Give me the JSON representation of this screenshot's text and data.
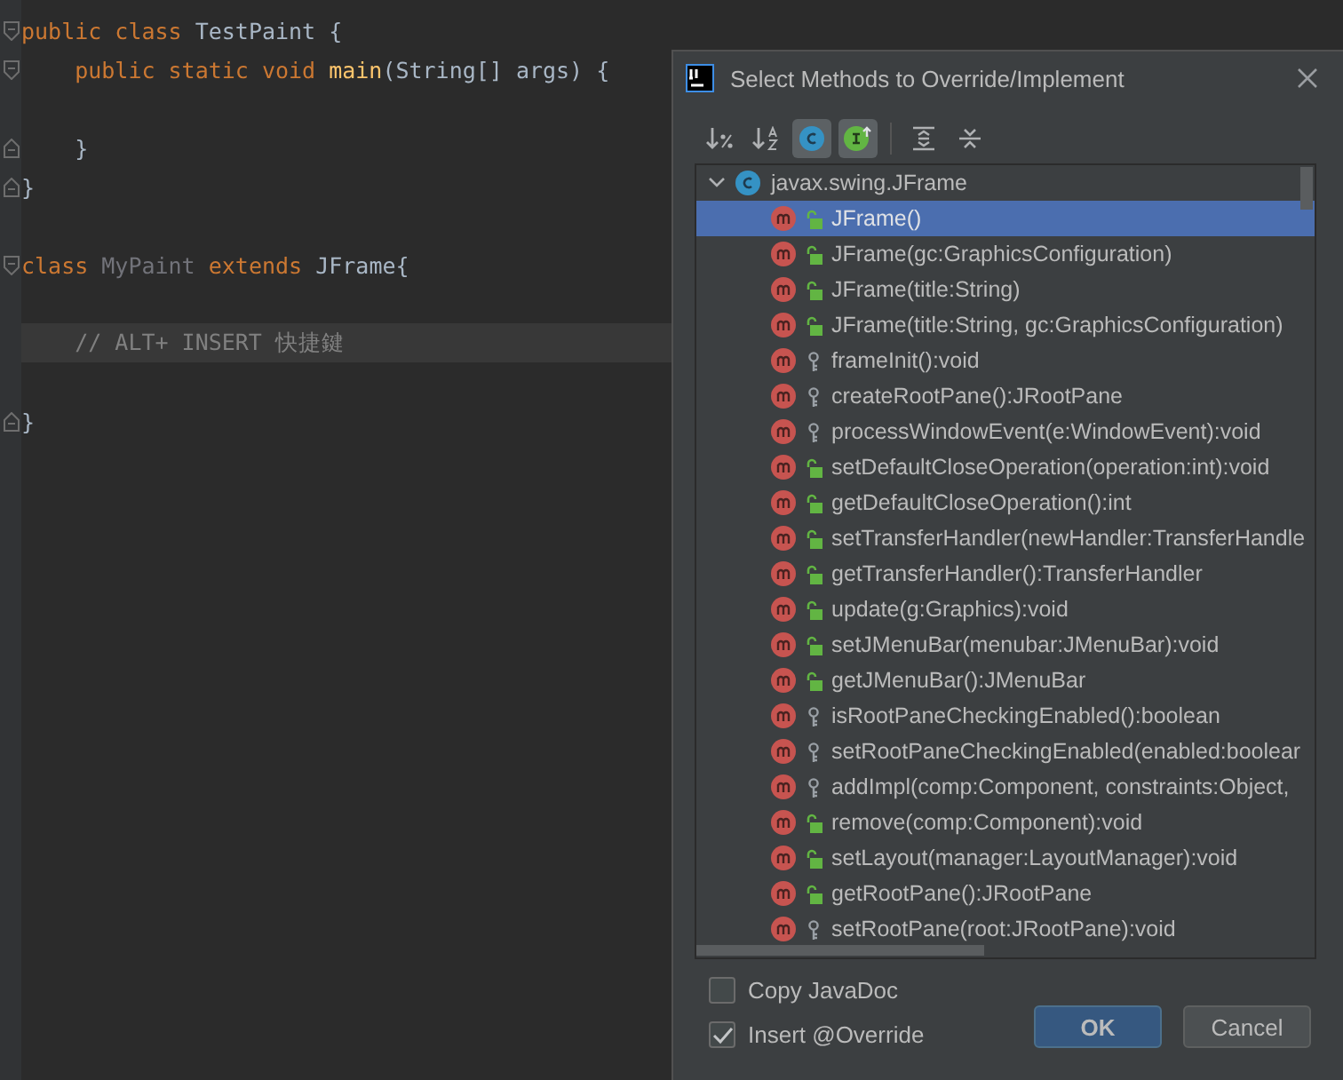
{
  "editor": {
    "lines": [
      {
        "kind": "fold-start",
        "current": false,
        "tokens": [
          {
            "kind": "keyword",
            "text": "public class "
          },
          {
            "kind": "plain",
            "text": "TestPaint {"
          }
        ]
      },
      {
        "kind": "fold-start",
        "current": false,
        "tokens": [
          {
            "kind": "keyword",
            "text": "    public static void "
          },
          {
            "kind": "method",
            "text": "main"
          },
          {
            "kind": "plain",
            "text": "(String[] args) {"
          }
        ]
      },
      {
        "kind": "blank",
        "current": false
      },
      {
        "kind": "fold-end",
        "current": false,
        "tokens": [
          {
            "kind": "plain",
            "text": "    }"
          }
        ]
      },
      {
        "kind": "fold-end",
        "current": false,
        "tokens": [
          {
            "kind": "plain",
            "text": "}"
          }
        ]
      },
      {
        "kind": "blank",
        "current": false
      },
      {
        "kind": "fold-start",
        "current": false,
        "tokens": [
          {
            "kind": "keyword",
            "text": "class "
          },
          {
            "kind": "unused",
            "text": "MyPaint "
          },
          {
            "kind": "keyword",
            "text": "extends "
          },
          {
            "kind": "plain",
            "text": "JFrame{"
          }
        ]
      },
      {
        "kind": "blank",
        "current": false
      },
      {
        "kind": "code",
        "current": true,
        "tokens": [
          {
            "kind": "comment",
            "text": "    // ALT+ INSERT 快捷鍵"
          }
        ]
      },
      {
        "kind": "blank",
        "current": false
      },
      {
        "kind": "fold-end",
        "current": false,
        "tokens": [
          {
            "kind": "plain",
            "text": "}"
          }
        ]
      }
    ]
  },
  "dialog": {
    "title": "Select Methods to Override/Implement",
    "toolbar": [
      {
        "kind": "sort-visibility",
        "on": false
      },
      {
        "kind": "sort-alpha",
        "on": false
      },
      {
        "kind": "classes",
        "on": true
      },
      {
        "kind": "interfaces",
        "on": true
      },
      {
        "kind": "expand",
        "on": false
      },
      {
        "kind": "collapse",
        "on": false
      }
    ],
    "tree": {
      "label": "javax.swing.JFrame",
      "expanded": true,
      "children": [
        {
          "label": "JFrame()",
          "kind": "public",
          "selected": true
        },
        {
          "label": "JFrame(gc:GraphicsConfiguration)",
          "kind": "public",
          "selected": false
        },
        {
          "label": "JFrame(title:String)",
          "kind": "public",
          "selected": false
        },
        {
          "label": "JFrame(title:String, gc:GraphicsConfiguration)",
          "kind": "public",
          "selected": false
        },
        {
          "label": "frameInit():void",
          "kind": "protected",
          "selected": false
        },
        {
          "label": "createRootPane():JRootPane",
          "kind": "protected",
          "selected": false
        },
        {
          "label": "processWindowEvent(e:WindowEvent):void",
          "kind": "protected",
          "selected": false
        },
        {
          "label": "setDefaultCloseOperation(operation:int):void",
          "kind": "public",
          "selected": false
        },
        {
          "label": "getDefaultCloseOperation():int",
          "kind": "public",
          "selected": false
        },
        {
          "label": "setTransferHandler(newHandler:TransferHandle",
          "kind": "public",
          "selected": false
        },
        {
          "label": "getTransferHandler():TransferHandler",
          "kind": "public",
          "selected": false
        },
        {
          "label": "update(g:Graphics):void",
          "kind": "public",
          "selected": false
        },
        {
          "label": "setJMenuBar(menubar:JMenuBar):void",
          "kind": "public",
          "selected": false
        },
        {
          "label": "getJMenuBar():JMenuBar",
          "kind": "public",
          "selected": false
        },
        {
          "label": "isRootPaneCheckingEnabled():boolean",
          "kind": "protected",
          "selected": false
        },
        {
          "label": "setRootPaneCheckingEnabled(enabled:boolear",
          "kind": "protected",
          "selected": false
        },
        {
          "label": "addImpl(comp:Component, constraints:Object,",
          "kind": "protected",
          "selected": false
        },
        {
          "label": "remove(comp:Component):void",
          "kind": "public",
          "selected": false
        },
        {
          "label": "setLayout(manager:LayoutManager):void",
          "kind": "public",
          "selected": false
        },
        {
          "label": "getRootPane():JRootPane",
          "kind": "public",
          "selected": false
        },
        {
          "label": "setRootPane(root:JRootPane):void",
          "kind": "protected",
          "selected": false
        }
      ]
    },
    "options": [
      {
        "label": "Copy JavaDoc",
        "checked": false
      },
      {
        "label": "Insert @Override",
        "checked": true
      }
    ],
    "buttons": [
      {
        "label": "OK",
        "default": true
      },
      {
        "label": "Cancel",
        "default": false
      }
    ]
  }
}
